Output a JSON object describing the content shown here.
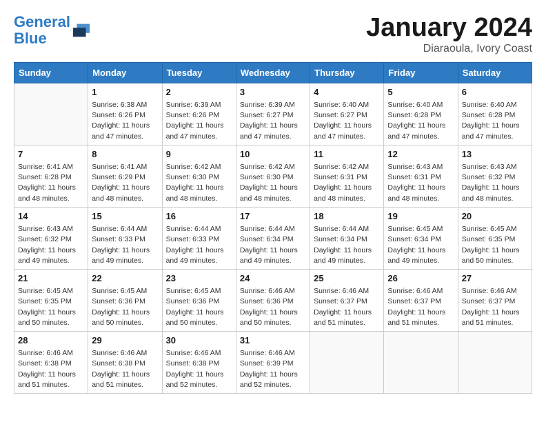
{
  "header": {
    "logo_line1": "General",
    "logo_line2": "Blue",
    "month": "January 2024",
    "location": "Diaraoula, Ivory Coast"
  },
  "weekdays": [
    "Sunday",
    "Monday",
    "Tuesday",
    "Wednesday",
    "Thursday",
    "Friday",
    "Saturday"
  ],
  "weeks": [
    [
      {
        "day": "",
        "detail": ""
      },
      {
        "day": "1",
        "detail": "Sunrise: 6:38 AM\nSunset: 6:26 PM\nDaylight: 11 hours\nand 47 minutes."
      },
      {
        "day": "2",
        "detail": "Sunrise: 6:39 AM\nSunset: 6:26 PM\nDaylight: 11 hours\nand 47 minutes."
      },
      {
        "day": "3",
        "detail": "Sunrise: 6:39 AM\nSunset: 6:27 PM\nDaylight: 11 hours\nand 47 minutes."
      },
      {
        "day": "4",
        "detail": "Sunrise: 6:40 AM\nSunset: 6:27 PM\nDaylight: 11 hours\nand 47 minutes."
      },
      {
        "day": "5",
        "detail": "Sunrise: 6:40 AM\nSunset: 6:28 PM\nDaylight: 11 hours\nand 47 minutes."
      },
      {
        "day": "6",
        "detail": "Sunrise: 6:40 AM\nSunset: 6:28 PM\nDaylight: 11 hours\nand 47 minutes."
      }
    ],
    [
      {
        "day": "7",
        "detail": "Sunrise: 6:41 AM\nSunset: 6:28 PM\nDaylight: 11 hours\nand 48 minutes."
      },
      {
        "day": "8",
        "detail": "Sunrise: 6:41 AM\nSunset: 6:29 PM\nDaylight: 11 hours\nand 48 minutes."
      },
      {
        "day": "9",
        "detail": "Sunrise: 6:42 AM\nSunset: 6:30 PM\nDaylight: 11 hours\nand 48 minutes."
      },
      {
        "day": "10",
        "detail": "Sunrise: 6:42 AM\nSunset: 6:30 PM\nDaylight: 11 hours\nand 48 minutes."
      },
      {
        "day": "11",
        "detail": "Sunrise: 6:42 AM\nSunset: 6:31 PM\nDaylight: 11 hours\nand 48 minutes."
      },
      {
        "day": "12",
        "detail": "Sunrise: 6:43 AM\nSunset: 6:31 PM\nDaylight: 11 hours\nand 48 minutes."
      },
      {
        "day": "13",
        "detail": "Sunrise: 6:43 AM\nSunset: 6:32 PM\nDaylight: 11 hours\nand 48 minutes."
      }
    ],
    [
      {
        "day": "14",
        "detail": "Sunrise: 6:43 AM\nSunset: 6:32 PM\nDaylight: 11 hours\nand 49 minutes."
      },
      {
        "day": "15",
        "detail": "Sunrise: 6:44 AM\nSunset: 6:33 PM\nDaylight: 11 hours\nand 49 minutes."
      },
      {
        "day": "16",
        "detail": "Sunrise: 6:44 AM\nSunset: 6:33 PM\nDaylight: 11 hours\nand 49 minutes."
      },
      {
        "day": "17",
        "detail": "Sunrise: 6:44 AM\nSunset: 6:34 PM\nDaylight: 11 hours\nand 49 minutes."
      },
      {
        "day": "18",
        "detail": "Sunrise: 6:44 AM\nSunset: 6:34 PM\nDaylight: 11 hours\nand 49 minutes."
      },
      {
        "day": "19",
        "detail": "Sunrise: 6:45 AM\nSunset: 6:34 PM\nDaylight: 11 hours\nand 49 minutes."
      },
      {
        "day": "20",
        "detail": "Sunrise: 6:45 AM\nSunset: 6:35 PM\nDaylight: 11 hours\nand 50 minutes."
      }
    ],
    [
      {
        "day": "21",
        "detail": "Sunrise: 6:45 AM\nSunset: 6:35 PM\nDaylight: 11 hours\nand 50 minutes."
      },
      {
        "day": "22",
        "detail": "Sunrise: 6:45 AM\nSunset: 6:36 PM\nDaylight: 11 hours\nand 50 minutes."
      },
      {
        "day": "23",
        "detail": "Sunrise: 6:45 AM\nSunset: 6:36 PM\nDaylight: 11 hours\nand 50 minutes."
      },
      {
        "day": "24",
        "detail": "Sunrise: 6:46 AM\nSunset: 6:36 PM\nDaylight: 11 hours\nand 50 minutes."
      },
      {
        "day": "25",
        "detail": "Sunrise: 6:46 AM\nSunset: 6:37 PM\nDaylight: 11 hours\nand 51 minutes."
      },
      {
        "day": "26",
        "detail": "Sunrise: 6:46 AM\nSunset: 6:37 PM\nDaylight: 11 hours\nand 51 minutes."
      },
      {
        "day": "27",
        "detail": "Sunrise: 6:46 AM\nSunset: 6:37 PM\nDaylight: 11 hours\nand 51 minutes."
      }
    ],
    [
      {
        "day": "28",
        "detail": "Sunrise: 6:46 AM\nSunset: 6:38 PM\nDaylight: 11 hours\nand 51 minutes."
      },
      {
        "day": "29",
        "detail": "Sunrise: 6:46 AM\nSunset: 6:38 PM\nDaylight: 11 hours\nand 51 minutes."
      },
      {
        "day": "30",
        "detail": "Sunrise: 6:46 AM\nSunset: 6:38 PM\nDaylight: 11 hours\nand 52 minutes."
      },
      {
        "day": "31",
        "detail": "Sunrise: 6:46 AM\nSunset: 6:39 PM\nDaylight: 11 hours\nand 52 minutes."
      },
      {
        "day": "",
        "detail": ""
      },
      {
        "day": "",
        "detail": ""
      },
      {
        "day": "",
        "detail": ""
      }
    ]
  ]
}
